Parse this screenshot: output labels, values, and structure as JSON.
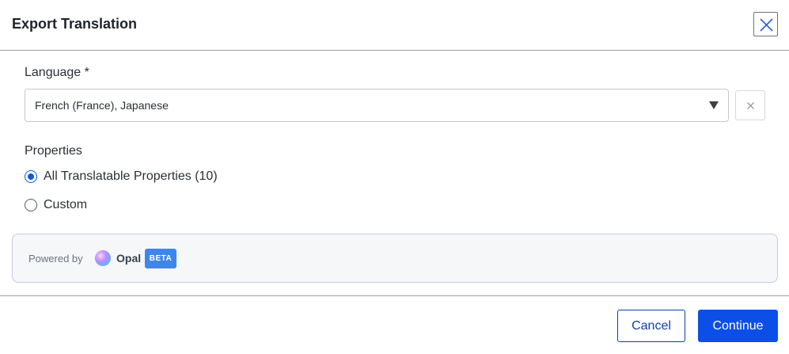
{
  "dialog": {
    "title": "Export Translation",
    "close_icon": "close-icon"
  },
  "language": {
    "label": "Language *",
    "selected_value": "French (France), Japanese",
    "caret_icon": "caret-down-icon",
    "clear_icon": "clear-x-icon"
  },
  "properties": {
    "label": "Properties",
    "options": [
      {
        "label": "All Translatable Properties (10)",
        "checked": true
      },
      {
        "label": "Custom",
        "checked": false
      }
    ]
  },
  "opal": {
    "powered_by": "Powered by",
    "name": "Opal",
    "badge": "BETA",
    "logo_icon": "opal-logo-icon"
  },
  "footer": {
    "cancel_label": "Cancel",
    "continue_label": "Continue"
  },
  "colors": {
    "accent": "#0b4fe8",
    "radio_selected": "#0d5cd8",
    "beta_badge": "#3f86ea",
    "cancel_border": "#0c3fa8"
  }
}
